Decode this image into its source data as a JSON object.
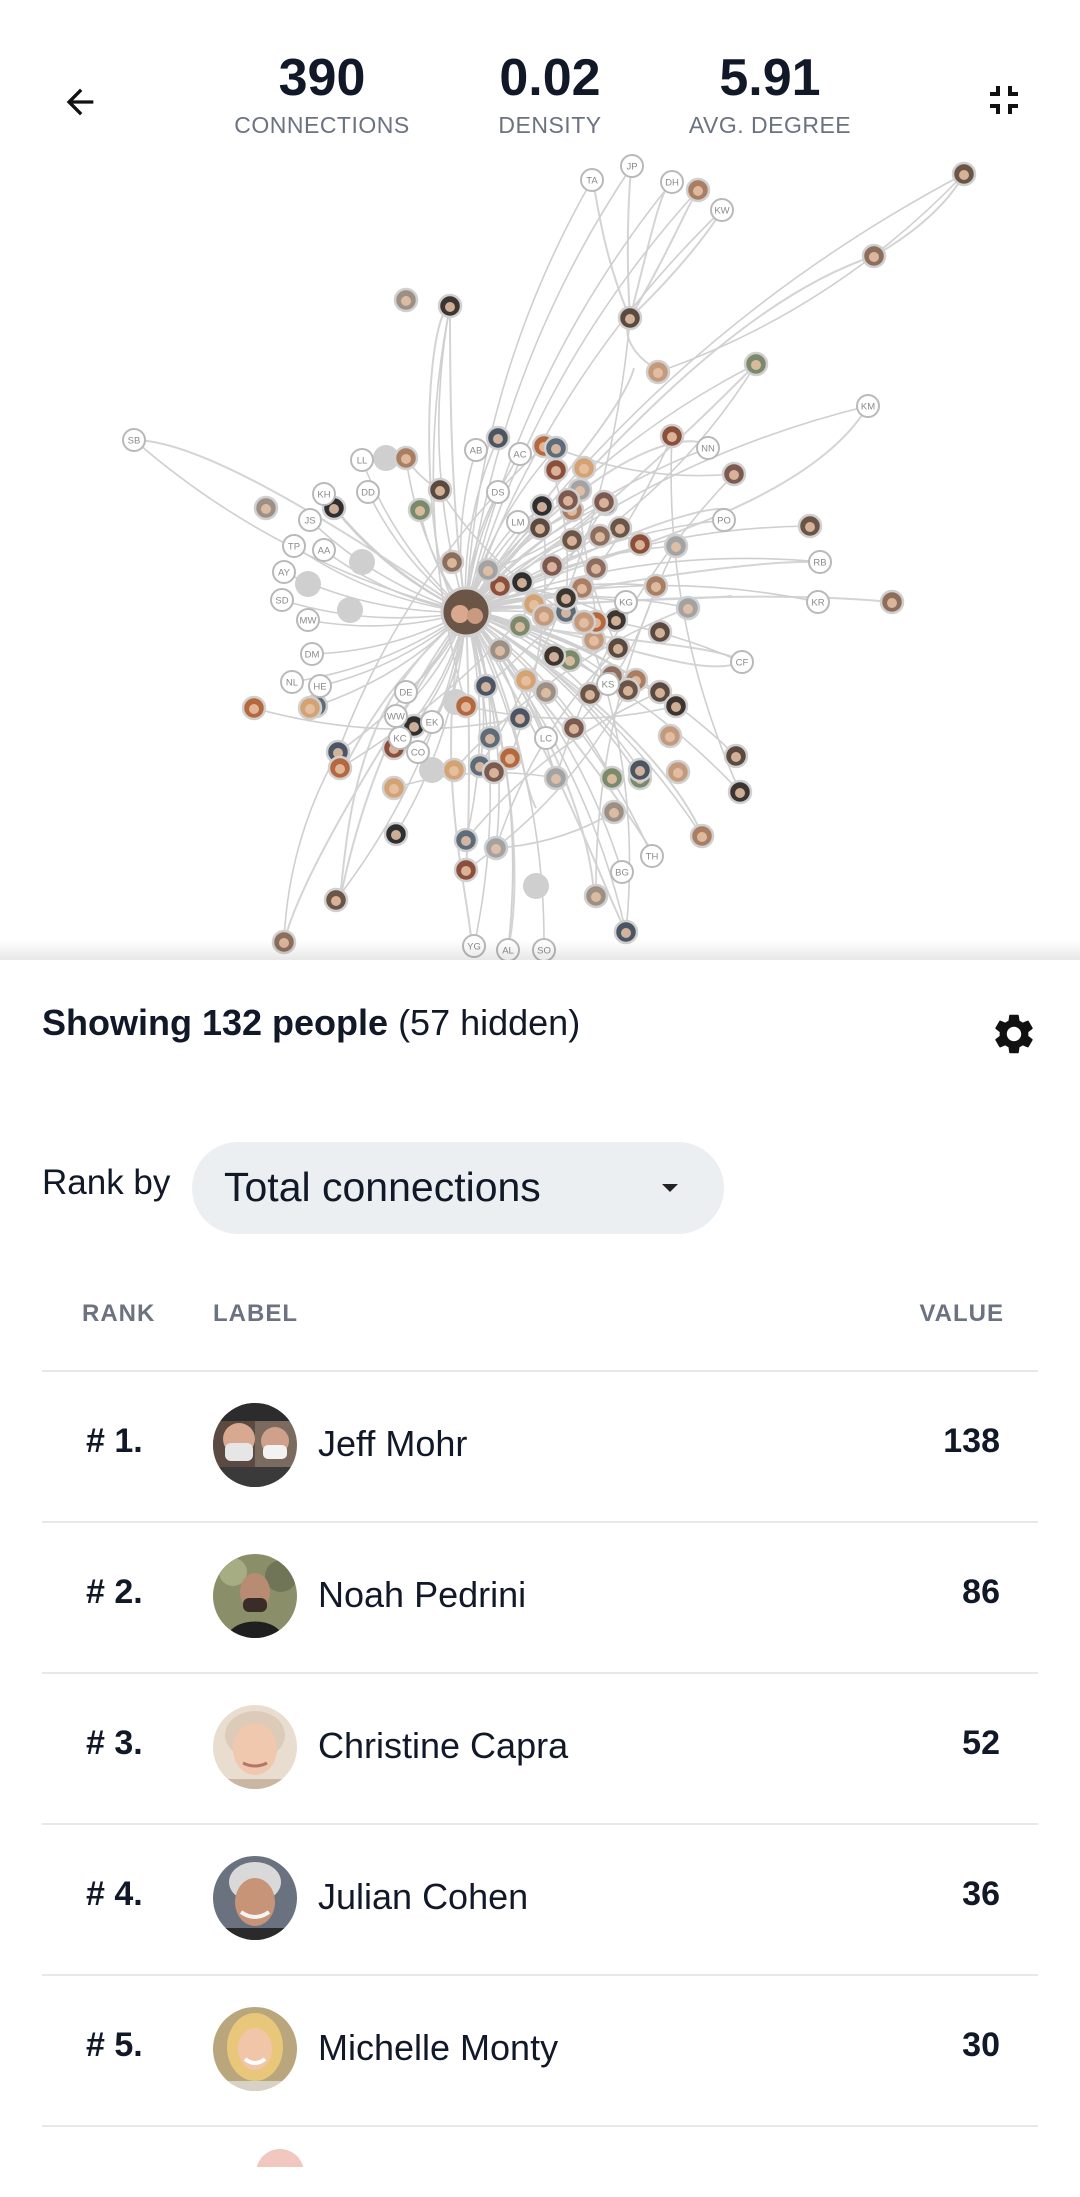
{
  "stats": [
    {
      "value": "390",
      "label": "CONNECTIONS"
    },
    {
      "value": "0.02",
      "label": "DENSITY"
    },
    {
      "value": "5.91",
      "label": "AVG. DEGREE"
    }
  ],
  "graph": {
    "initial_labels": [
      "TA",
      "JP",
      "DH",
      "KW",
      "KM",
      "SB",
      "NN",
      "AB",
      "AC",
      "LL",
      "KH",
      "DD",
      "DS",
      "LM",
      "JS",
      "PO",
      "TP",
      "AA",
      "AY",
      "RB",
      "SD",
      "KG",
      "KR",
      "MW",
      "DM",
      "CF",
      "NL",
      "HE",
      "KS",
      "DE",
      "WW",
      "EK",
      "KC",
      "LC",
      "CO",
      "TH",
      "BG",
      "YG",
      "AL",
      "SO"
    ]
  },
  "panel": {
    "showing_bold": "Showing 132 people",
    "showing_rest": " (57 hidden)",
    "rank_by_label": "Rank by",
    "rank_by_value": "Total connections",
    "columns": {
      "rank": "RANK",
      "label": "LABEL",
      "value": "VALUE"
    },
    "rows": [
      {
        "rank": "# 1.",
        "name": "Jeff Mohr",
        "value": "138"
      },
      {
        "rank": "# 2.",
        "name": "Noah Pedrini",
        "value": "86"
      },
      {
        "rank": "# 3.",
        "name": "Christine Capra",
        "value": "52"
      },
      {
        "rank": "# 4.",
        "name": "Julian Cohen",
        "value": "36"
      },
      {
        "rank": "# 5.",
        "name": "Michelle Monty",
        "value": "30"
      }
    ]
  },
  "icons": {
    "back": "arrow-back-icon",
    "collapse": "collapse-arrows-icon",
    "settings": "gear-icon",
    "dropdown": "caret-down-icon"
  }
}
